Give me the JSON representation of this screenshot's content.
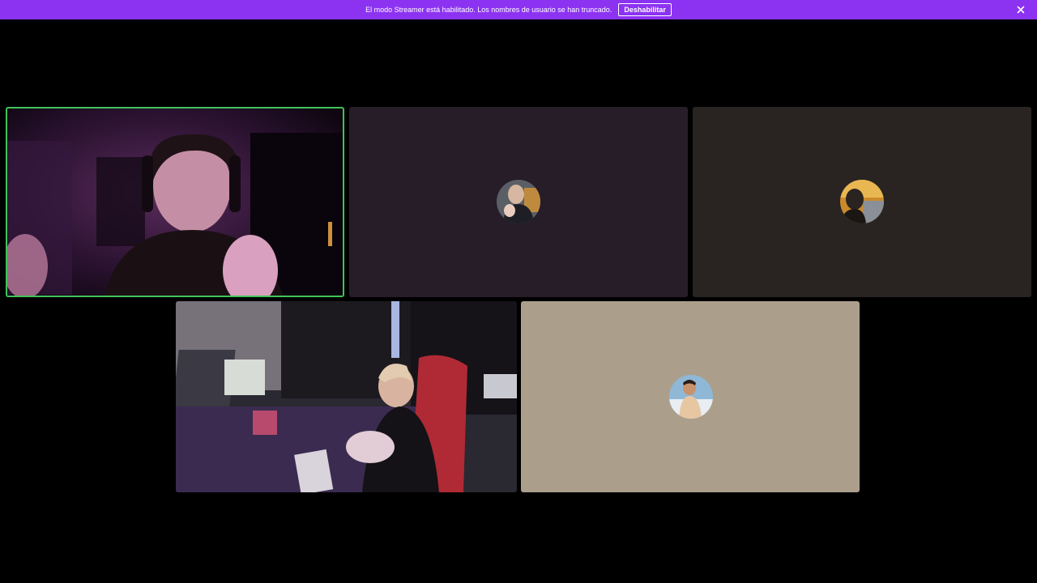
{
  "banner": {
    "message": "El modo Streamer está habilitado. Los nombres de usuario se han truncado.",
    "disable_label": "Deshabilitar",
    "close_icon": "close-icon",
    "background": "#8c33f2"
  },
  "participants": [
    {
      "kind": "video",
      "speaking": true,
      "speaking_color": "#3fc35a"
    },
    {
      "kind": "avatar",
      "background": "#261d29",
      "avatar_icon": "user-avatar-icon"
    },
    {
      "kind": "avatar",
      "background": "#292422",
      "avatar_icon": "user-avatar-icon"
    },
    {
      "kind": "video",
      "speaking": false
    },
    {
      "kind": "avatar",
      "background": "#ab9f8c",
      "avatar_icon": "user-avatar-icon"
    }
  ]
}
